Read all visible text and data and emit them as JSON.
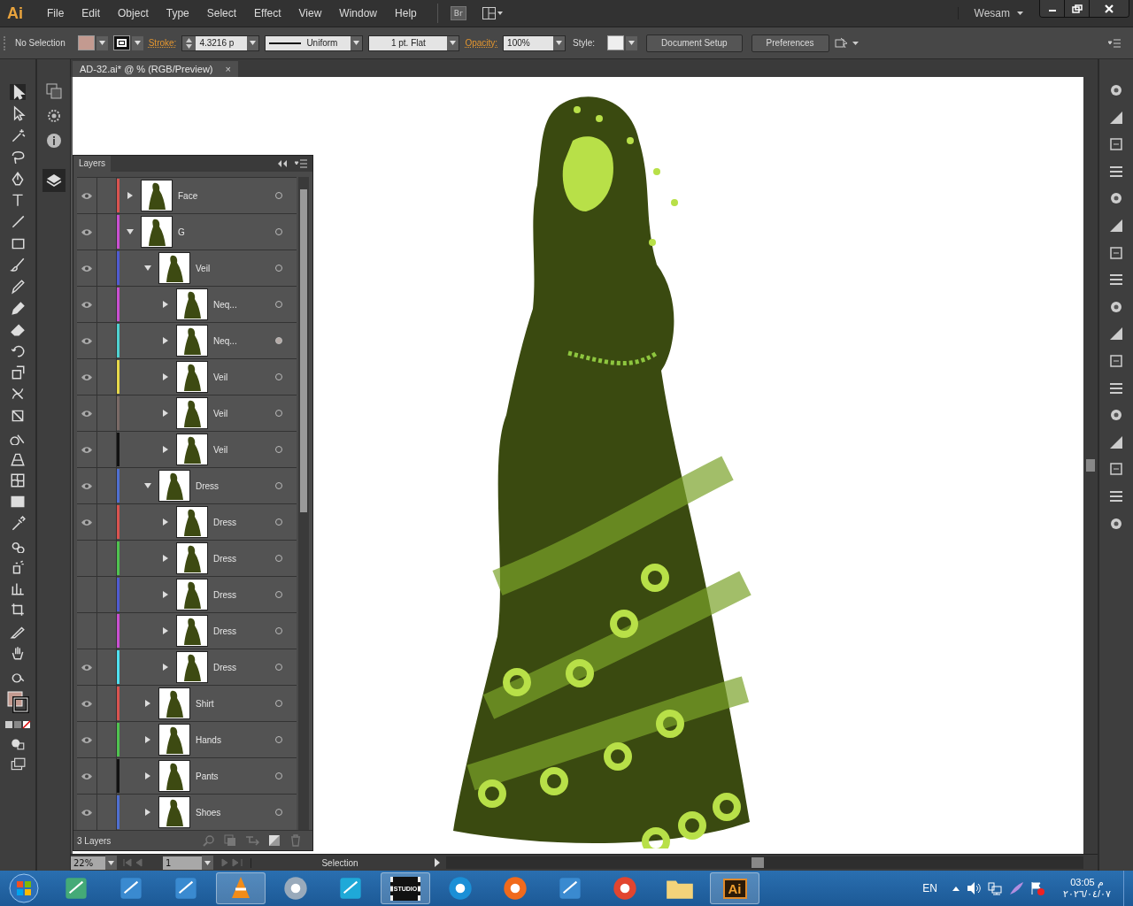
{
  "app": {
    "logo": "Ai",
    "menu": [
      "File",
      "Edit",
      "Object",
      "Type",
      "Select",
      "Effect",
      "View",
      "Window",
      "Help"
    ],
    "bridge": "Br",
    "workspace": "Wesam"
  },
  "control_bar": {
    "selection": "No Selection",
    "stroke_label": "Stroke:",
    "stroke_weight": "4.3216 p",
    "profile": "Uniform",
    "brush": "1 pt. Flat",
    "opacity_label": "Opacity:",
    "opacity": "100%",
    "style_label": "Style:",
    "buttons": [
      "Document Setup",
      "Preferences"
    ]
  },
  "document_tab": {
    "title": "AD-32.ai* @ % (RGB/Preview)",
    "close": "×"
  },
  "layers_panel": {
    "title": "Layers",
    "footer": "3 Layers",
    "layers": [
      {
        "name": "Face",
        "color": "#d9534f",
        "visible": true,
        "expanded": false,
        "targeted": false
      },
      {
        "name": "G",
        "color": "#c94fd0",
        "visible": true,
        "expanded": true,
        "targeted": false,
        "children": [
          {
            "name": "Veil",
            "color": "#4f5bd0",
            "visible": true,
            "expanded": true,
            "targeted": false,
            "children": [
              {
                "name": "Neq...",
                "color": "#c94fd0",
                "visible": true,
                "expanded": false,
                "targeted": false
              },
              {
                "name": "Neq...",
                "color": "#4fd0d0",
                "visible": true,
                "expanded": false,
                "targeted": true
              },
              {
                "name": "Veil",
                "color": "#e6d84a",
                "visible": true,
                "expanded": false,
                "targeted": false
              },
              {
                "name": "Veil",
                "color": "#7a6a66",
                "visible": true,
                "expanded": false,
                "targeted": false
              },
              {
                "name": "Veil",
                "color": "#111111",
                "visible": true,
                "expanded": false,
                "targeted": false
              }
            ]
          },
          {
            "name": "Dress",
            "color": "#4f6fd0",
            "visible": true,
            "expanded": true,
            "targeted": false,
            "children": [
              {
                "name": "Dress",
                "color": "#d9534f",
                "visible": true,
                "expanded": false,
                "targeted": false
              },
              {
                "name": "Dress",
                "color": "#4fc24f",
                "visible": false,
                "expanded": false,
                "targeted": false
              },
              {
                "name": "Dress",
                "color": "#4f5bd0",
                "visible": false,
                "expanded": false,
                "targeted": false
              },
              {
                "name": "Dress",
                "color": "#c94fd0",
                "visible": false,
                "expanded": false,
                "targeted": false
              },
              {
                "name": "Dress",
                "color": "#4fe0f0",
                "visible": true,
                "expanded": false,
                "targeted": false
              }
            ]
          },
          {
            "name": "Shirt",
            "color": "#d9534f",
            "visible": true,
            "expanded": false,
            "targeted": false
          },
          {
            "name": "Hands",
            "color": "#4fc24f",
            "visible": true,
            "expanded": false,
            "targeted": false
          },
          {
            "name": "Pants",
            "color": "#111111",
            "visible": true,
            "expanded": false,
            "targeted": false
          },
          {
            "name": "Shoes",
            "color": "#4f6fd0",
            "visible": true,
            "expanded": false,
            "targeted": false
          }
        ]
      }
    ]
  },
  "status_bar": {
    "zoom": "22%",
    "page": "1",
    "tool": "Selection"
  },
  "taskbar": {
    "studio_badge": "STUDIO",
    "active_app": "Ai",
    "language": "EN",
    "time": "03:05 م",
    "date": "٢٠٢٦/٠٤/٠٧"
  }
}
